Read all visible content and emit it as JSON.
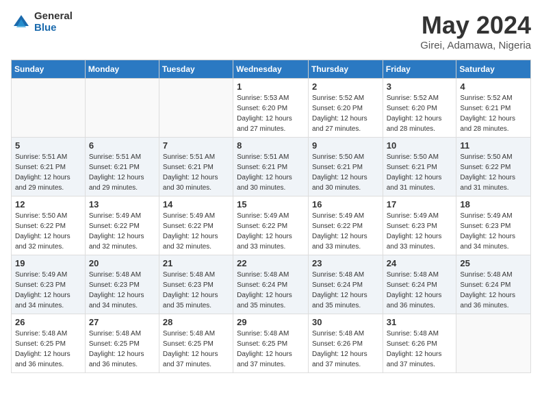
{
  "header": {
    "logo_general": "General",
    "logo_blue": "Blue",
    "title": "May 2024",
    "subtitle": "Girei, Adamawa, Nigeria"
  },
  "days_of_week": [
    "Sunday",
    "Monday",
    "Tuesday",
    "Wednesday",
    "Thursday",
    "Friday",
    "Saturday"
  ],
  "weeks": [
    [
      {
        "day": "",
        "info": ""
      },
      {
        "day": "",
        "info": ""
      },
      {
        "day": "",
        "info": ""
      },
      {
        "day": "1",
        "info": "Sunrise: 5:53 AM\nSunset: 6:20 PM\nDaylight: 12 hours\nand 27 minutes."
      },
      {
        "day": "2",
        "info": "Sunrise: 5:52 AM\nSunset: 6:20 PM\nDaylight: 12 hours\nand 27 minutes."
      },
      {
        "day": "3",
        "info": "Sunrise: 5:52 AM\nSunset: 6:20 PM\nDaylight: 12 hours\nand 28 minutes."
      },
      {
        "day": "4",
        "info": "Sunrise: 5:52 AM\nSunset: 6:21 PM\nDaylight: 12 hours\nand 28 minutes."
      }
    ],
    [
      {
        "day": "5",
        "info": "Sunrise: 5:51 AM\nSunset: 6:21 PM\nDaylight: 12 hours\nand 29 minutes."
      },
      {
        "day": "6",
        "info": "Sunrise: 5:51 AM\nSunset: 6:21 PM\nDaylight: 12 hours\nand 29 minutes."
      },
      {
        "day": "7",
        "info": "Sunrise: 5:51 AM\nSunset: 6:21 PM\nDaylight: 12 hours\nand 30 minutes."
      },
      {
        "day": "8",
        "info": "Sunrise: 5:51 AM\nSunset: 6:21 PM\nDaylight: 12 hours\nand 30 minutes."
      },
      {
        "day": "9",
        "info": "Sunrise: 5:50 AM\nSunset: 6:21 PM\nDaylight: 12 hours\nand 30 minutes."
      },
      {
        "day": "10",
        "info": "Sunrise: 5:50 AM\nSunset: 6:21 PM\nDaylight: 12 hours\nand 31 minutes."
      },
      {
        "day": "11",
        "info": "Sunrise: 5:50 AM\nSunset: 6:22 PM\nDaylight: 12 hours\nand 31 minutes."
      }
    ],
    [
      {
        "day": "12",
        "info": "Sunrise: 5:50 AM\nSunset: 6:22 PM\nDaylight: 12 hours\nand 32 minutes."
      },
      {
        "day": "13",
        "info": "Sunrise: 5:49 AM\nSunset: 6:22 PM\nDaylight: 12 hours\nand 32 minutes."
      },
      {
        "day": "14",
        "info": "Sunrise: 5:49 AM\nSunset: 6:22 PM\nDaylight: 12 hours\nand 32 minutes."
      },
      {
        "day": "15",
        "info": "Sunrise: 5:49 AM\nSunset: 6:22 PM\nDaylight: 12 hours\nand 33 minutes."
      },
      {
        "day": "16",
        "info": "Sunrise: 5:49 AM\nSunset: 6:22 PM\nDaylight: 12 hours\nand 33 minutes."
      },
      {
        "day": "17",
        "info": "Sunrise: 5:49 AM\nSunset: 6:23 PM\nDaylight: 12 hours\nand 33 minutes."
      },
      {
        "day": "18",
        "info": "Sunrise: 5:49 AM\nSunset: 6:23 PM\nDaylight: 12 hours\nand 34 minutes."
      }
    ],
    [
      {
        "day": "19",
        "info": "Sunrise: 5:49 AM\nSunset: 6:23 PM\nDaylight: 12 hours\nand 34 minutes."
      },
      {
        "day": "20",
        "info": "Sunrise: 5:48 AM\nSunset: 6:23 PM\nDaylight: 12 hours\nand 34 minutes."
      },
      {
        "day": "21",
        "info": "Sunrise: 5:48 AM\nSunset: 6:23 PM\nDaylight: 12 hours\nand 35 minutes."
      },
      {
        "day": "22",
        "info": "Sunrise: 5:48 AM\nSunset: 6:24 PM\nDaylight: 12 hours\nand 35 minutes."
      },
      {
        "day": "23",
        "info": "Sunrise: 5:48 AM\nSunset: 6:24 PM\nDaylight: 12 hours\nand 35 minutes."
      },
      {
        "day": "24",
        "info": "Sunrise: 5:48 AM\nSunset: 6:24 PM\nDaylight: 12 hours\nand 36 minutes."
      },
      {
        "day": "25",
        "info": "Sunrise: 5:48 AM\nSunset: 6:24 PM\nDaylight: 12 hours\nand 36 minutes."
      }
    ],
    [
      {
        "day": "26",
        "info": "Sunrise: 5:48 AM\nSunset: 6:25 PM\nDaylight: 12 hours\nand 36 minutes."
      },
      {
        "day": "27",
        "info": "Sunrise: 5:48 AM\nSunset: 6:25 PM\nDaylight: 12 hours\nand 36 minutes."
      },
      {
        "day": "28",
        "info": "Sunrise: 5:48 AM\nSunset: 6:25 PM\nDaylight: 12 hours\nand 37 minutes."
      },
      {
        "day": "29",
        "info": "Sunrise: 5:48 AM\nSunset: 6:25 PM\nDaylight: 12 hours\nand 37 minutes."
      },
      {
        "day": "30",
        "info": "Sunrise: 5:48 AM\nSunset: 6:26 PM\nDaylight: 12 hours\nand 37 minutes."
      },
      {
        "day": "31",
        "info": "Sunrise: 5:48 AM\nSunset: 6:26 PM\nDaylight: 12 hours\nand 37 minutes."
      },
      {
        "day": "",
        "info": ""
      }
    ]
  ]
}
